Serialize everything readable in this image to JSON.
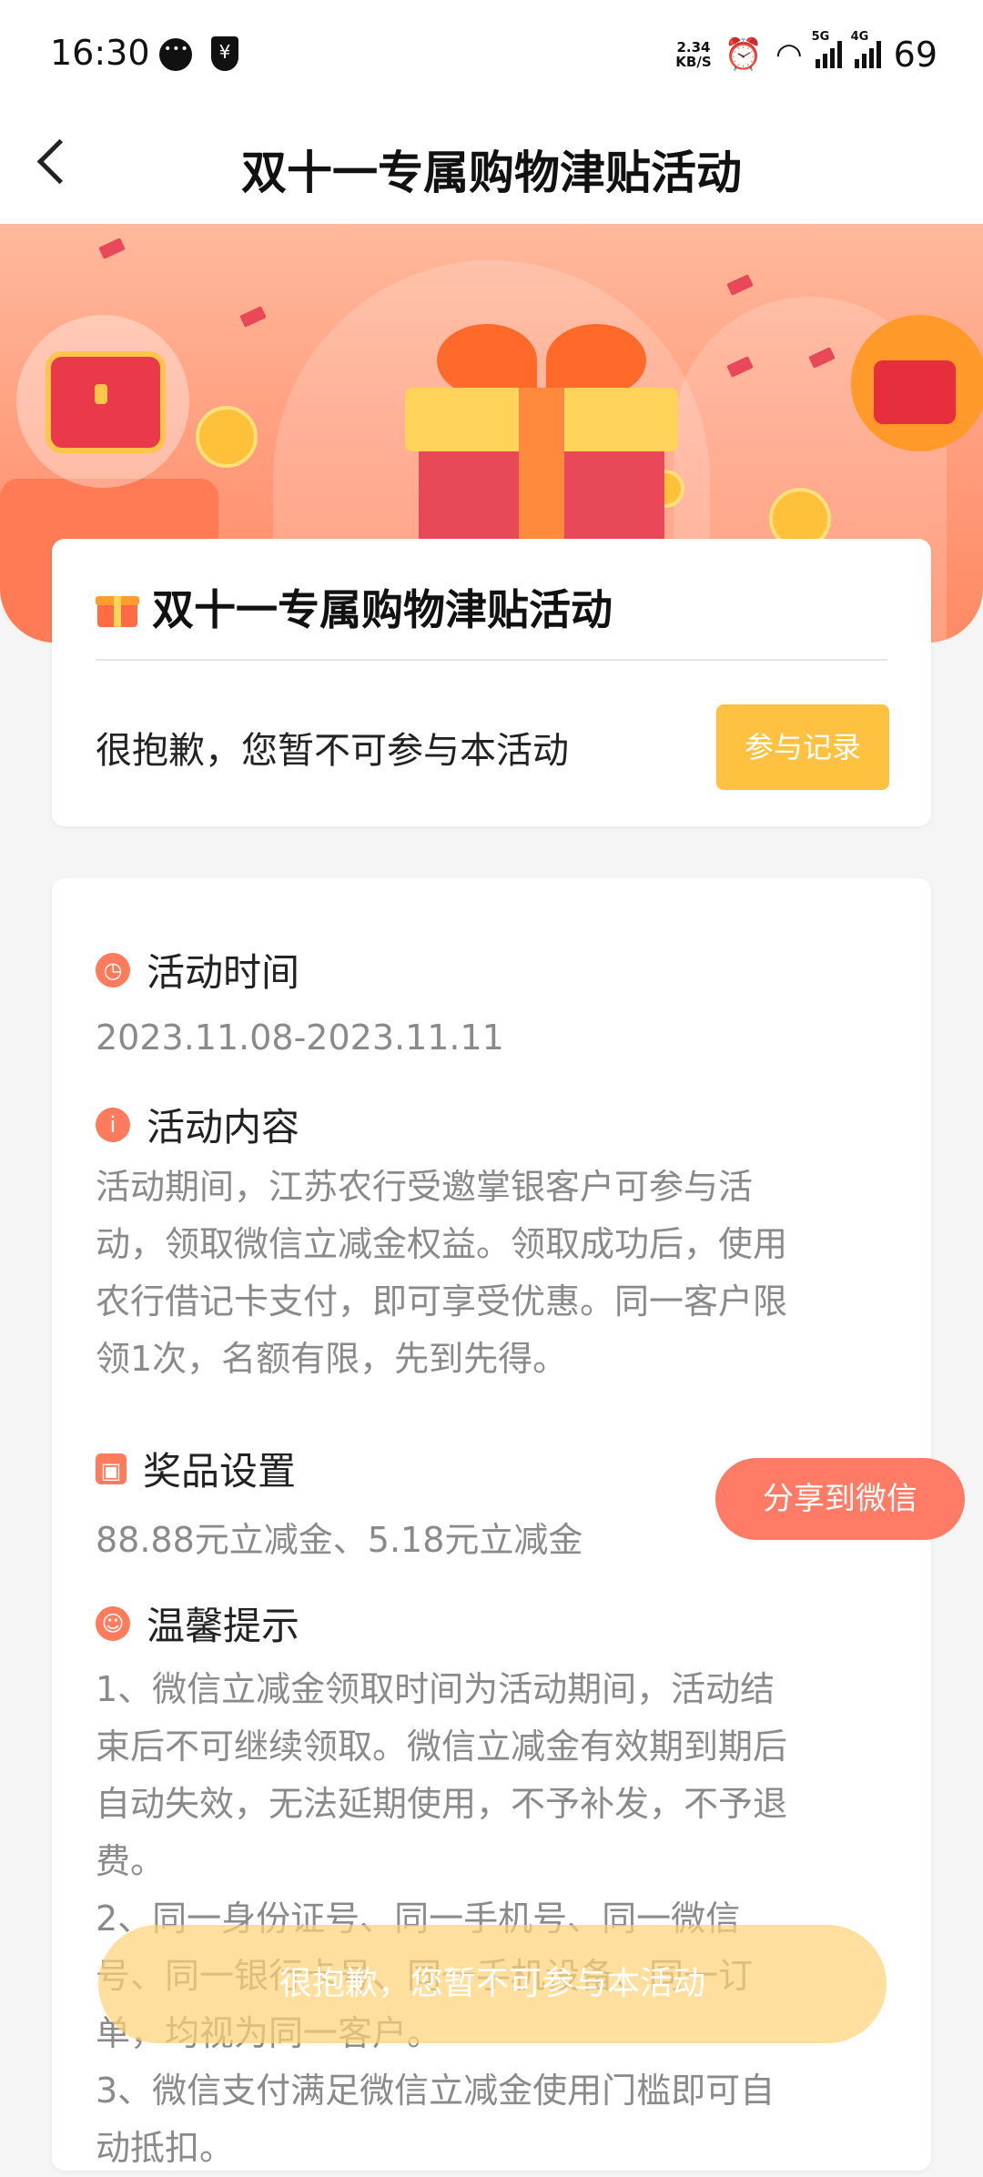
{
  "status_bar": {
    "time": "16:30",
    "speed_top": "2.34",
    "speed_bottom": "KB/S",
    "network1": "5G",
    "network2": "4G",
    "battery": "69"
  },
  "nav": {
    "title": "双十一专属购物津贴活动"
  },
  "card_activity": {
    "title": "双十一专属购物津贴活动",
    "notice": "很抱歉，您暂不可参与本活动",
    "record_button": "参与记录"
  },
  "details": {
    "time_title": "活动时间",
    "time_value": "2023.11.08-2023.11.11",
    "content_title": "活动内容",
    "content_text": "活动期间，江苏农行受邀掌银客户可参与活\n动，领取微信立减金权益。领取成功后，使用\n农行借记卡支付，即可享受优惠。同一客户限\n领1次，名额有限，先到先得。",
    "prize_title": "奖品设置",
    "prize_value": "88.88元立减金、5.18元立减金",
    "tips_title": "温馨提示",
    "tips_text": "1、微信立减金领取时间为活动期间，活动结\n束后不可继续领取。微信立减金有效期到期后\n自动失效，无法延期使用，不予补发，不予退\n费。\n2、同一身份证号、同一手机号、同一微信\n号、同一银行卡号、同一手机设备、同一订\n单，均视为同一客户。\n3、微信支付满足微信立减金使用门槛即可自\n动抵扣。"
  },
  "floating": {
    "share_button": "分享到微信",
    "toast": "很抱歉，您暂不可参与本活动"
  }
}
